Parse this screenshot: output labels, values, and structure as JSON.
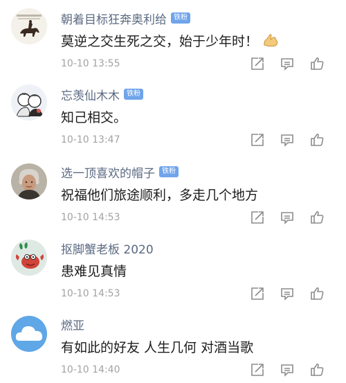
{
  "comments": [
    {
      "username": "朝着目标狂奔奥利给",
      "badge": "铁粉",
      "text": "莫逆之交生死之交，始于少年时！",
      "has_emoji": true,
      "emoji_icon": "folded-hands-icon",
      "time": "10-10 13:55",
      "avatar_icon": "horse-rider-avatar",
      "avatar_colors": {
        "bg": "#f4f1ea",
        "fg": "#3a2a20"
      }
    },
    {
      "username": "忘羡仙木木",
      "badge": "铁粉",
      "text": "知己相交。",
      "has_emoji": false,
      "time": "10-10 13:47",
      "avatar_icon": "cartoon-duo-avatar",
      "avatar_colors": {
        "bg": "#eef2f7",
        "fg": "#2b2b2b"
      }
    },
    {
      "username": "选一顶喜欢的帽子",
      "badge": "铁粉",
      "text": "祝福他们旅途顺利，多走几个地方",
      "has_emoji": false,
      "time": "10-10 14:53",
      "avatar_icon": "portrait-photo-avatar",
      "avatar_colors": {
        "bg": "#b9b2a6",
        "fg": "#3b3530"
      }
    },
    {
      "username": "抠脚蟹老板 2020",
      "badge": "",
      "text": "患难见真情",
      "has_emoji": false,
      "time": "10-10 14:53",
      "avatar_icon": "cartoon-crab-avatar",
      "avatar_colors": {
        "bg": "#dfe9e4",
        "fg": "#d0443a"
      }
    },
    {
      "username": "燃亚",
      "badge": "",
      "text": "有如此的好友 人生几何 对酒当歌",
      "has_emoji": false,
      "time": "10-10 14:40",
      "avatar_icon": "blue-cloud-avatar",
      "avatar_colors": {
        "bg": "#5fa7e6",
        "fg": "#ffffff"
      }
    }
  ],
  "action_icons": [
    "share-icon",
    "reply-icon",
    "like-icon"
  ],
  "colors": {
    "username": "#5b6a82",
    "badge_bg": "#6fa4ea",
    "time": "#a2a2a2",
    "icon": "#8c8c8c"
  }
}
